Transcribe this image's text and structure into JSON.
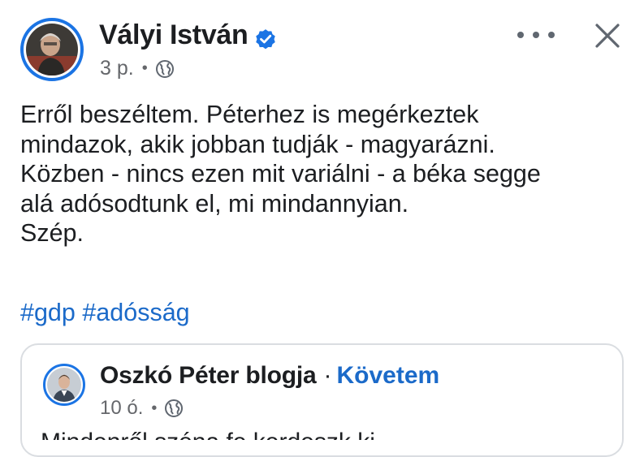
{
  "post": {
    "author": "Vályi István",
    "time": "3 p.",
    "audience_icon": "globe-icon",
    "text_lines": [
      "Erről beszéltem. Péterhez is megérkeztek",
      "mindazok, akik jobban tudják - magyarázni.",
      "Közben - nincs ezen mit variálni - a béka segge",
      "alá adósodtunk el, mi mindannyian.",
      "Szép."
    ],
    "hashtags": [
      "#gdp",
      "#adósság"
    ]
  },
  "shared": {
    "author": "Oszkó Péter blogja",
    "separator": "·",
    "follow_label": "Követem",
    "time": "10 ó.",
    "text_fragment": "Mindenről szóna fe kerdeszk ki"
  },
  "colors": {
    "link": "#1b6ac9",
    "accent": "#1b74e4",
    "muted": "#65676b"
  }
}
